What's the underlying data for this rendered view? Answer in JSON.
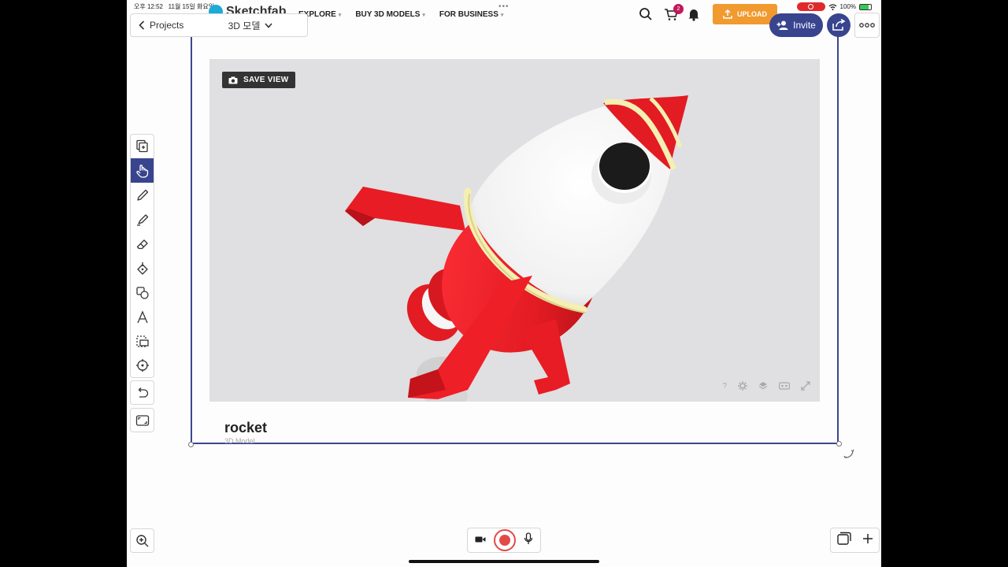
{
  "status_bar": {
    "time": "오후 12:52",
    "date": "11월 15일 화요일",
    "battery": "100%"
  },
  "sketchfab": {
    "logo_text": "Sketchfab",
    "nav": [
      "EXPLORE",
      "BUY 3D MODELS",
      "FOR BUSINESS"
    ],
    "cart_count": "2",
    "upload_label": "UPLOAD"
  },
  "header": {
    "back_label": "Projects",
    "doc_title": "3D 모델",
    "invite_label": "Invite"
  },
  "tools": [
    "insert-page",
    "hand",
    "pen",
    "highlighter",
    "eraser",
    "fill",
    "shapes",
    "text",
    "lasso-select",
    "laser-pointer"
  ],
  "viewer": {
    "save_view_label": "SAVE VIEW",
    "help_label": "?"
  },
  "model": {
    "title": "rocket",
    "subtitle": "3D Model"
  },
  "colors": {
    "accent": "#39448f",
    "upload": "#f09a30",
    "record": "#e24a4a",
    "rocket_red": "#e41b23",
    "rocket_ring": "#f2eeb0"
  }
}
